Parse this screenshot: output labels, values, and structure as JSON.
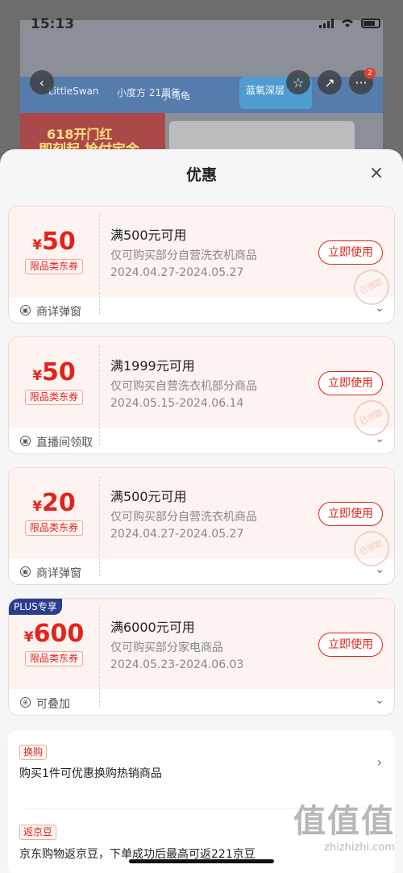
{
  "status_bar": {
    "time": "15:13"
  },
  "background": {
    "logos": [
      "LittleSwan",
      "小度方 21周年",
      "小乌龟"
    ],
    "promo_line1": "618开门红",
    "promo_line2": "即刻起 抢付定金",
    "blue_box_title": "蓝氧深层",
    "notification_count": "2"
  },
  "sheet": {
    "title": "优惠",
    "close_icon": "close-icon"
  },
  "coupons": [
    {
      "currency": "¥",
      "amount": "50",
      "category": "限品类东券",
      "condition": "满500元可用",
      "scope": "仅可购买部分自营洗衣机商品",
      "dates": "2024.04.27-2024.05.27",
      "button": "立即使用",
      "stamp": "已领取",
      "source": "商详弹窗",
      "badge": ""
    },
    {
      "currency": "¥",
      "amount": "50",
      "category": "限品类东券",
      "condition": "满1999元可用",
      "scope": "仅可购买自营洗衣机部分商品",
      "dates": "2024.05.15-2024.06.14",
      "button": "立即使用",
      "stamp": "已领取",
      "source": "直播间领取",
      "badge": ""
    },
    {
      "currency": "¥",
      "amount": "20",
      "category": "限品类东券",
      "condition": "满500元可用",
      "scope": "仅可购买部分自营洗衣机商品",
      "dates": "2024.04.27-2024.05.27",
      "button": "立即使用",
      "stamp": "已领取",
      "source": "商详弹窗",
      "badge": ""
    },
    {
      "currency": "¥",
      "amount": "600",
      "category": "限品类东券",
      "condition": "满6000元可用",
      "scope": "仅可购买部分家电商品",
      "dates": "2024.05.23-2024.06.03",
      "button": "立即使用",
      "stamp": "",
      "source": "可叠加",
      "badge": "PLUS专享"
    }
  ],
  "promos": [
    {
      "tag": "换购",
      "text": "购买1件可优惠换购热销商品"
    },
    {
      "tag": "返京豆",
      "text": "京东购物返京豆，下单成功后最高可返221京豆"
    }
  ],
  "watermark": {
    "big": "值值值",
    "small": "zhizhizhi.com"
  },
  "colors": {
    "accent": "#e2231a",
    "plus": "#2b3d8f"
  }
}
